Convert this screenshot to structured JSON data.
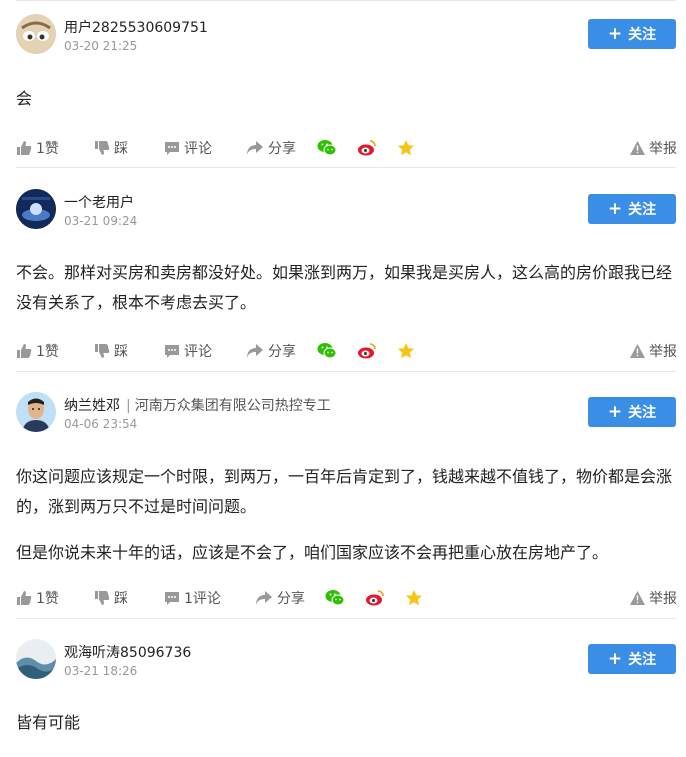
{
  "follow_label": "关注",
  "posts": [
    {
      "username": "用户2825530609751",
      "org": "",
      "time": "03-20 21:25",
      "paragraphs": [
        "会"
      ],
      "likes": "1赞",
      "dislike": "踩",
      "comments": "评论",
      "share": "分享",
      "report": "举报"
    },
    {
      "username": "一个老用户",
      "org": "",
      "time": "03-21 09:24",
      "paragraphs": [
        "不会。那样对买房和卖房都没好处。如果涨到两万，如果我是买房人，这么高的房价跟我已经没有关系了，根本不考虑去买了。"
      ],
      "likes": "1赞",
      "dislike": "踩",
      "comments": "评论",
      "share": "分享",
      "report": "举报"
    },
    {
      "username": "纳兰姓邓",
      "org": "河南万众集团有限公司热控专工",
      "time": "04-06 23:54",
      "paragraphs": [
        "你这问题应该规定一个时限，到两万，一百年后肯定到了，钱越来越不值钱了，物价都是会涨的，涨到两万只不过是时间问题。",
        "但是你说未来十年的话，应该是不会了，咱们国家应该不会再把重心放在房地产了。"
      ],
      "likes": "1赞",
      "dislike": "踩",
      "comments": "1评论",
      "share": "分享",
      "report": "举报"
    },
    {
      "username": "观海听涛85096736",
      "org": "",
      "time": "03-21 18:26",
      "paragraphs": [
        "皆有可能"
      ]
    }
  ],
  "colors": {
    "accent": "#3a8ee6",
    "wechat": "#2dc100",
    "weibo": "#e6162d",
    "favorite": "#f5c518"
  }
}
